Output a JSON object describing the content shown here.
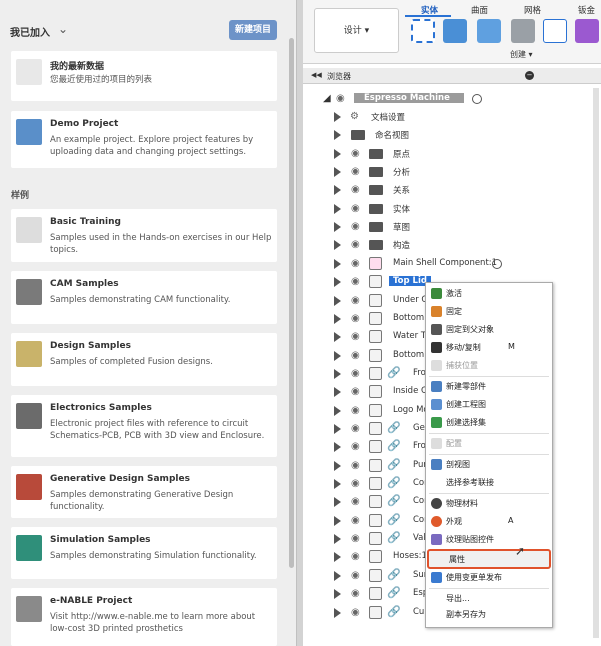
{
  "left": {
    "header": "我已加入",
    "new_project": "新建项目",
    "cards": [
      {
        "title": "我的最新数据",
        "desc": "您最近使用过的项目的列表",
        "icon": "document-icon",
        "color": "#e8e8e8"
      },
      {
        "title": "Demo Project",
        "desc": "An example project. Explore project features by uploading data and changing project settings.",
        "icon": "demo-project-icon",
        "color": "#5a8fc9"
      }
    ],
    "samples_header": "样例",
    "samples": [
      {
        "title": "Basic Training",
        "desc": "Samples used in the Hands-on exercises in our Help topics.",
        "icon": "graduation-cap-icon",
        "color": "#dddddd"
      },
      {
        "title": "CAM Samples",
        "desc": "Samples demonstrating CAM functionality.",
        "icon": "cam-machine-icon",
        "color": "#7a7a7a"
      },
      {
        "title": "Design Samples",
        "desc": "Samples of completed Fusion designs.",
        "icon": "design-sample-icon",
        "color": "#c9b36a"
      },
      {
        "title": "Electronics Samples",
        "desc": "Electronic project files with reference to circuit Schematics-PCB, PCB with 3D view and Enclosure.",
        "icon": "electronics-board-icon",
        "color": "#6b6b6b"
      },
      {
        "title": "Generative Design Samples",
        "desc": "Samples demonstrating Generative Design functionality.",
        "icon": "generative-design-icon",
        "color": "#b84a3a"
      },
      {
        "title": "Simulation Samples",
        "desc": "Samples demonstrating Simulation functionality.",
        "icon": "simulation-icon",
        "color": "#2f8f7a"
      },
      {
        "title": "e-NABLE Project",
        "desc": "Visit http://www.e-nable.me to learn more about low-cost 3D printed prosthetics",
        "icon": "enable-hand-icon",
        "color": "#8a8a8a"
      }
    ]
  },
  "toolbar": {
    "design": "设计 ▾",
    "tabs": [
      "实体",
      "曲面",
      "网格",
      "钣金"
    ],
    "create": "创建 ▾"
  },
  "browser": {
    "title": "浏览器",
    "root": "Espresso Machine",
    "rows": [
      "文档设置",
      "命名视图",
      "原点",
      "分析",
      "关系",
      "实体",
      "草图",
      "构造",
      "Main Shell Component:1",
      "Top Lid",
      "Under Co",
      "Bottom S",
      "Water Ta",
      "Bottom F",
      "Fro",
      "Inside Co",
      "Logo Mo",
      "Ger",
      "Fro",
      "Pum",
      "Cor",
      "Cor",
      "Cor",
      "Valv",
      "Hoses:1",
      "Sur",
      "Esp",
      "Cup"
    ]
  },
  "menu": {
    "items": [
      {
        "label": "激活",
        "icon": "check-icon",
        "color": "#3b8a3b"
      },
      {
        "label": "固定",
        "icon": "pin-icon",
        "color": "#d9822b"
      },
      {
        "label": "固定到父对象",
        "icon": "anchor-icon",
        "color": "#555555"
      },
      {
        "label": "移动/复制",
        "shortcut": "M",
        "icon": "move-icon",
        "color": "#333333"
      },
      {
        "label": "捕获位置",
        "icon": "capture-position-icon",
        "color": "#aaaaaa",
        "disabled": true
      },
      {
        "label": "新建零部件",
        "icon": "new-component-icon",
        "color": "#4a7fc1"
      },
      {
        "label": "创建工程图",
        "icon": "drawing-icon",
        "color": "#5b8fd0"
      },
      {
        "label": "创建选择集",
        "icon": "selection-set-icon",
        "color": "#3a9a4a"
      },
      {
        "label": "配置",
        "icon": "configure-icon",
        "color": "#aaaaaa",
        "disabled": true
      },
      {
        "label": "剖视图",
        "icon": "section-view-icon",
        "color": "#4a7fc1"
      },
      {
        "label": "选择参考联接",
        "icon": "",
        "color": ""
      },
      {
        "label": "物理材料",
        "icon": "material-icon",
        "color": "#444444"
      },
      {
        "label": "外观",
        "shortcut": "A",
        "icon": "appearance-icon",
        "color": "#e05a2b"
      },
      {
        "label": "纹理贴图控件",
        "icon": "texture-icon",
        "color": "#7a6ac0"
      },
      {
        "label": "属性",
        "icon": "",
        "color": ""
      },
      {
        "label": "使用变更单发布",
        "icon": "release-icon",
        "color": "#3a7ad0"
      },
      {
        "label": "导出...",
        "icon": "",
        "color": ""
      },
      {
        "label": "副本另存为",
        "icon": "",
        "color": ""
      },
      {
        "label": "另存为网格",
        "icon": "",
        "color": ""
      }
    ]
  }
}
